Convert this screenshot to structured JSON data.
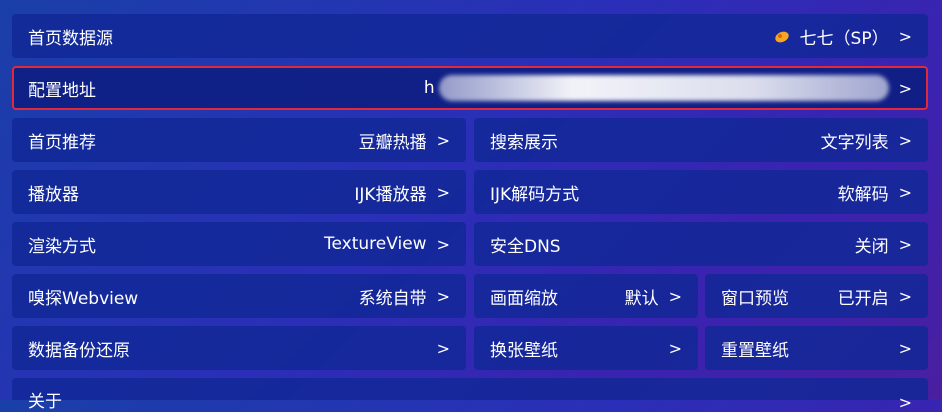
{
  "rows": {
    "home_source": {
      "label": "首页数据源",
      "value": "七七（SP）",
      "icon": "orange-leaf-icon"
    },
    "config_url": {
      "label": "配置地址",
      "value": "h"
    },
    "home_recommend": {
      "label": "首页推荐",
      "value": "豆瓣热播"
    },
    "search_display": {
      "label": "搜索展示",
      "value": "文字列表"
    },
    "player": {
      "label": "播放器",
      "value": "IJK播放器"
    },
    "ijk_decode": {
      "label": "IJK解码方式",
      "value": "软解码"
    },
    "render_mode": {
      "label": "渲染方式",
      "value": "TextureView"
    },
    "secure_dns": {
      "label": "安全DNS",
      "value": "关闭"
    },
    "sniff_webview": {
      "label": "嗅探Webview",
      "value": "系统自带"
    },
    "picture_scale": {
      "label": "画面缩放",
      "value": "默认"
    },
    "window_preview": {
      "label": "窗口预览",
      "value": "已开启"
    },
    "backup_restore": {
      "label": "数据备份还原"
    },
    "change_wallpaper": {
      "label": "换张壁纸"
    },
    "reset_wallpaper": {
      "label": "重置壁纸"
    },
    "about": {
      "label": "关于"
    }
  },
  "chevron": ">",
  "colors": {
    "focus_border": "#e02a3a",
    "tile_bg": "#12289a",
    "icon": "#f5a623"
  }
}
